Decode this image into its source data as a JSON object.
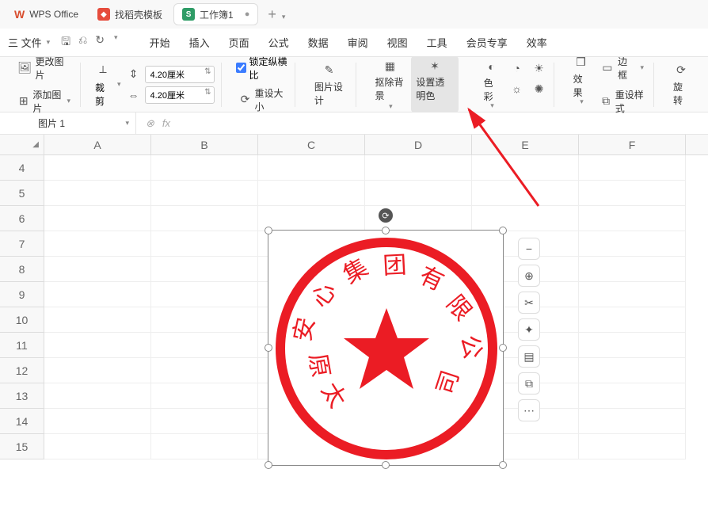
{
  "titlebar": {
    "tab1_label": "WPS Office",
    "tab2_label": "找稻壳模板",
    "tab3_label": "工作簿1",
    "tab3_close_glyph": "●",
    "add_glyph": "+"
  },
  "menubar": {
    "file_label": "三 文件",
    "quick_save": "🖫",
    "quick_undo": "⎌",
    "quick_redo": "↻",
    "tabs": [
      "开始",
      "插入",
      "页面",
      "公式",
      "数据",
      "审阅",
      "视图",
      "工具",
      "会员专享",
      "效率"
    ]
  },
  "toolbar": {
    "change_pic": "更改图片",
    "add_pic": "添加图片",
    "crop": "裁剪",
    "size_h": "4.20厘米",
    "size_w": "4.20厘米",
    "lock_ratio": "锁定纵横比",
    "reset_size": "重设大小",
    "pic_design": "图片设计",
    "remove_bg": "抠除背景",
    "set_transparent": "设置透明色",
    "color": "色彩",
    "effect": "效果",
    "border": "边框",
    "reset_style": "重设样式",
    "rotate": "旋转"
  },
  "namebox": {
    "value": "图片 1"
  },
  "columns": [
    "A",
    "B",
    "C",
    "D",
    "E",
    "F"
  ],
  "rows": [
    "4",
    "5",
    "6",
    "7",
    "8",
    "9",
    "10",
    "11",
    "12",
    "13",
    "14",
    "15"
  ],
  "stamp_text": [
    "太",
    "原",
    "安",
    "心",
    "集",
    "团",
    "有",
    "限",
    "公",
    "司"
  ]
}
